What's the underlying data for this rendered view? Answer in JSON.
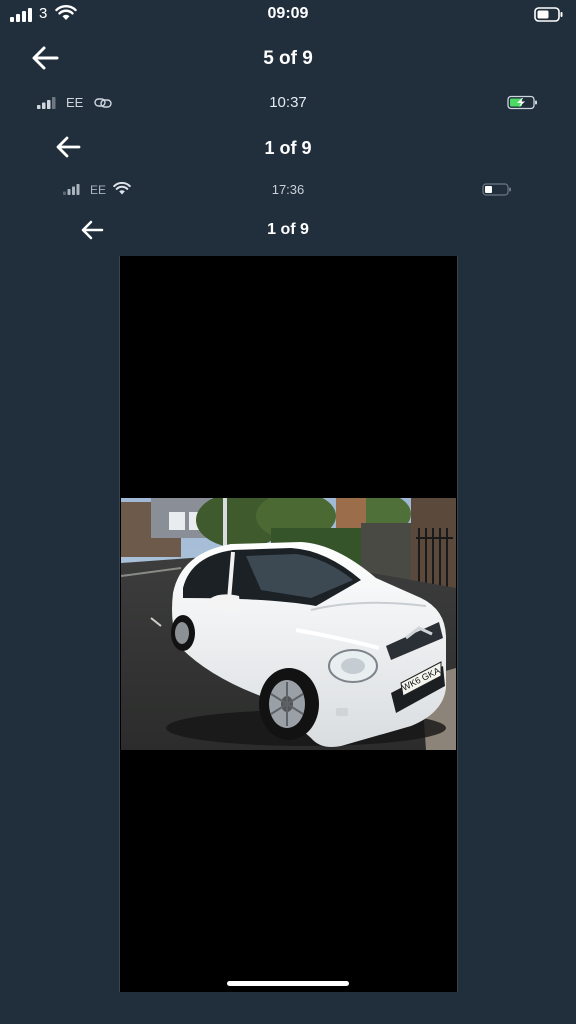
{
  "status_bar_outer": {
    "carrier": "3",
    "time": "09:09"
  },
  "header_outer": {
    "counter": "5 of 9"
  },
  "status_bar_middle": {
    "carrier": "EE",
    "time": "10:37",
    "battery_color": "#4cd964"
  },
  "header_middle": {
    "counter": "1 of 9"
  },
  "status_bar_inner": {
    "carrier": "EE",
    "time": "17:36"
  },
  "header_inner": {
    "counter": "1 of 9"
  },
  "photo": {
    "subject": "white hatchback car parked on a street",
    "plate_text": "WK6 GKA"
  },
  "colors": {
    "background": "#212e3c",
    "viewer_background": "#000000",
    "text": "#ffffff"
  },
  "icons": {
    "back": "back-arrow-icon",
    "signal": "signal-icon",
    "wifi": "wifi-icon",
    "battery": "battery-icon",
    "link": "link-icon"
  }
}
